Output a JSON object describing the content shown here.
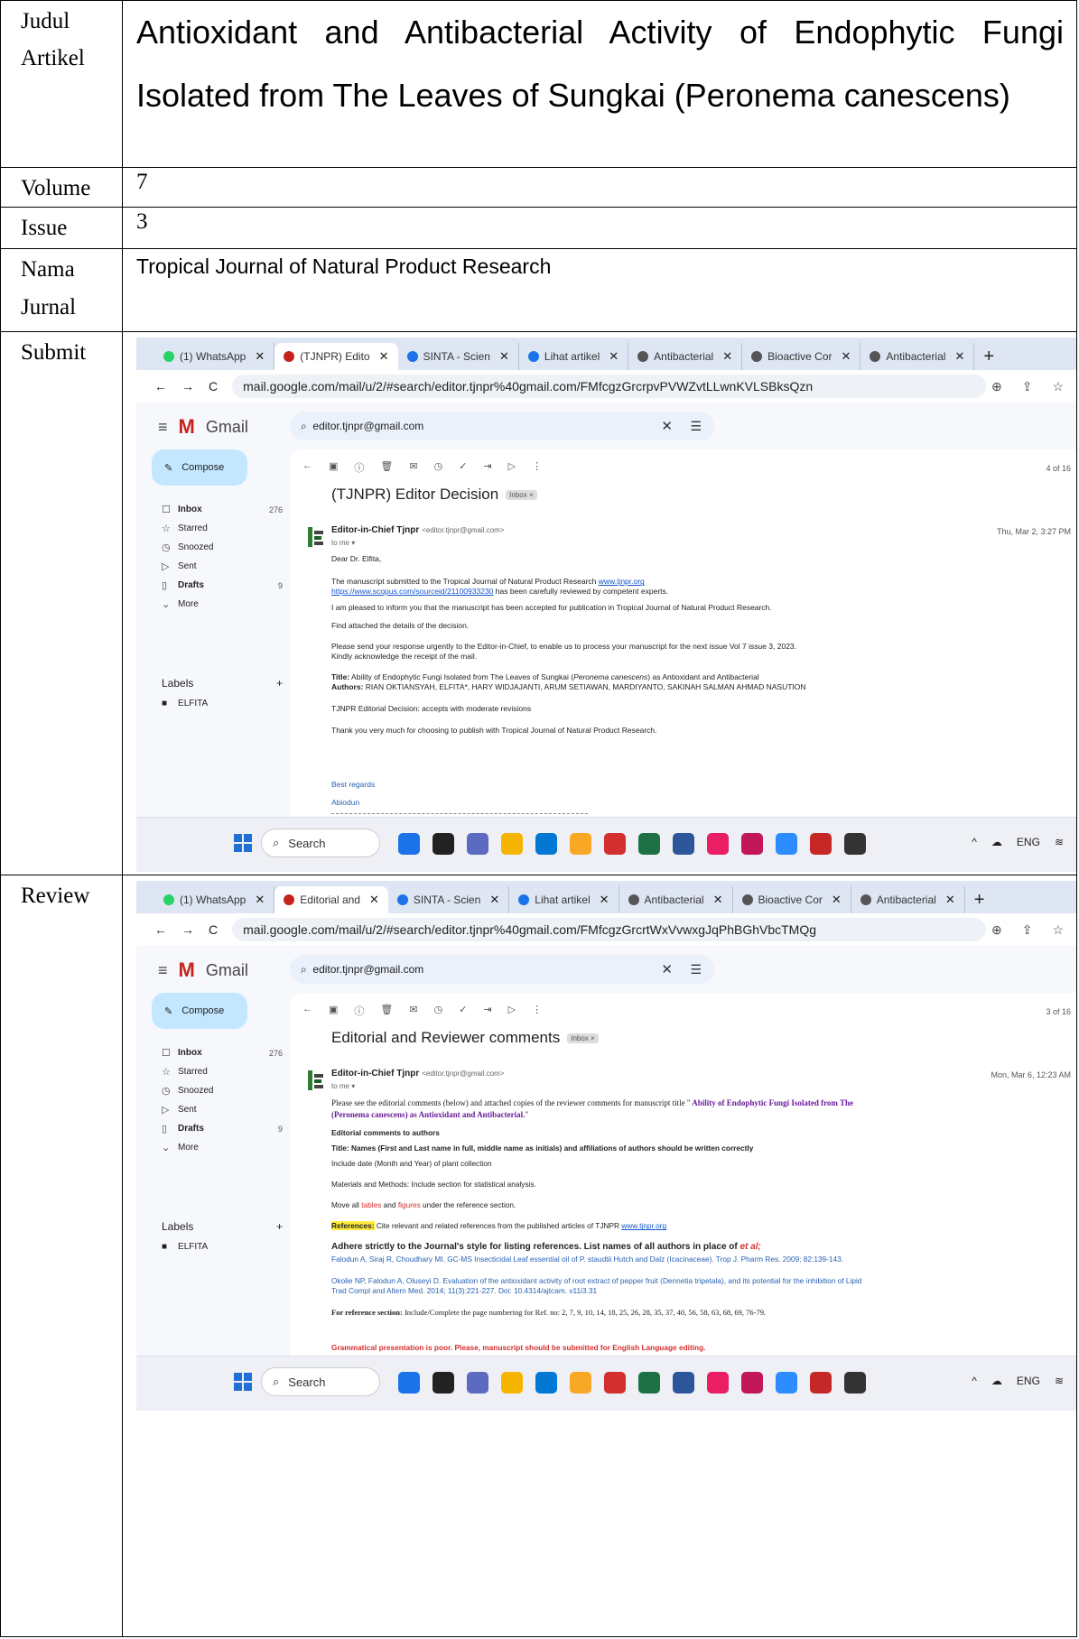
{
  "doc": {
    "rows": {
      "judul": {
        "label": "Judul Artikel",
        "value": "Antioxidant and Antibacterial Activity of Endophytic Fungi Isolated from The Leaves of Sungkai (Peronema canescens)"
      },
      "volume": {
        "label": "Volume",
        "value": "7"
      },
      "issue": {
        "label": "Issue",
        "value": "3"
      },
      "nama": {
        "label": "Nama Jurnal",
        "value": "Tropical Journal of Natural Product Research"
      },
      "submit": {
        "label": "Submit"
      },
      "review": {
        "label": "Review"
      }
    }
  },
  "colors": {
    "accent": "#1155cc",
    "compose": "#c2e7ff",
    "highlight": "#ffeb3b",
    "warning": "#d32f2f"
  },
  "browser": {
    "tabs_submit": [
      "(1) WhatsApp",
      "(TJNPR) Edito",
      "SINTA - Scien",
      "Lihat artikel",
      "Antibacterial",
      "Bioactive Cor",
      "Antibacterial"
    ],
    "tabs_review": [
      "(1) WhatsApp",
      "Editorial and",
      "SINTA - Scien",
      "Lihat artikel",
      "Antibacterial",
      "Bioactive Cor",
      "Antibacterial"
    ],
    "url_submit": "mail.google.com/mail/u/2/#search/editor.tjnpr%40gmail.com/FMfcgzGrcrpvPVWZvtLLwnKVLSBksQzn",
    "url_review": "mail.google.com/mail/u/2/#search/editor.tjnpr%40gmail.com/FMfcgzGrcrtWxVvwxgJqPhBGhVbcTMQg"
  },
  "gmail": {
    "brand": "Gmail",
    "search": "editor.tjnpr@gmail.com",
    "compose": "Compose",
    "nav": [
      {
        "label": "Inbox",
        "count": "276",
        "icon": "inbox-icon",
        "glyph": "☐"
      },
      {
        "label": "Starred",
        "count": "",
        "icon": "star-icon",
        "glyph": "☆"
      },
      {
        "label": "Snoozed",
        "count": "",
        "icon": "clock-icon",
        "glyph": "◷"
      },
      {
        "label": "Sent",
        "count": "",
        "icon": "send-icon",
        "glyph": "▷"
      },
      {
        "label": "Drafts",
        "count": "9",
        "icon": "draft-icon",
        "glyph": "▯"
      },
      {
        "label": "More",
        "count": "",
        "icon": "chevron-down-icon",
        "glyph": "⌄"
      }
    ],
    "labels_heading": "Labels",
    "label_item": "ELFITA",
    "taskbar_search": "Search",
    "tray_lang": "ENG"
  },
  "email_submit": {
    "subject": "(TJNPR) Editor Decision",
    "chip": "Inbox ×",
    "pager": "4 of 16",
    "sender_name": "Editor-in-Chief Tjnpr",
    "sender_email": "<editor.tjnpr@gmail.com>",
    "to": "to me ▾",
    "date": "Thu, Mar 2, 3:27 PM",
    "greeting": "Dear Dr. Elfita,",
    "p1": "The manuscript submitted to the Tropical Journal of Natural Product Research ",
    "p1_link": "www.tjnpr.org",
    "p2_link": "https://www.scopus.com/sourceid/21100933230",
    "p2": "  has been carefully reviewed by competent experts.",
    "p3": " I am pleased to inform you that the manuscript has been accepted for publication in Tropical Journal of Natural Product Research.",
    "p4": "Find attached the details of the decision.",
    "p5": "Please send your response urgently to the Editor-in-Chief, to enable us to process your manuscript for the next issue Vol 7 issue 3,   2023.",
    "p6": "Kindly acknowledge the receipt of the mail.",
    "title_label": "Title:",
    "title_text": " Ability of Endophytic Fungi Isolated from The Leaves of Sungkai (",
    "title_italic": "Peronema canescens",
    "title_end": ") as Antioxidant and Antibacterial",
    "authors_label": "Authors:",
    "authors_text": " RIAN OKTIANSYAH, ELFITA*, HARY WIDJAJANTI, ARUM SETIAWAN, MARDIYANTO, SAKINAH SALMAN AHMAD NASUTION",
    "decision": "TJNPR Editorial Decision: accepts with moderate revisions",
    "thanks": "Thank you very much for choosing to publish with Tropical Journal of Natural Product Research.",
    "regards": "Best regards",
    "signer": "Abiodun"
  },
  "email_review": {
    "subject": "Editorial and Reviewer comments",
    "chip": "Inbox ×",
    "pager": "3 of 16",
    "sender_name": "Editor-in-Chief Tjnpr",
    "sender_email": "<editor.tjnpr@gmail.com>",
    "to": "to me ▾",
    "date": "Mon, Mar 6, 12:23 AM",
    "intro": "Please see the editorial comments (below) and attached copies of the reviewer comments for manuscript title \"",
    "intro_title": " Ability of Endophytic Fungi Isolated from The",
    "intro_title2": "(Peronema canescens) as Antioxidant and Antibacterial.",
    "intro_end": "\"",
    "c1": "Editorial comments to authors",
    "c2": "Title: Names (First and Last name in full, middle name as initials) and affiliations of authors should be written correctly",
    "c3": "Include date (Month and Year) of plant collection",
    "c4": "Materials and Methods: Include section for statistical analysis.",
    "c5a": "Move all ",
    "c5b": "tables",
    "c5c": " and ",
    "c5d": "figures",
    "c5e": " under the reference section.",
    "c6a": "References:",
    "c6b": " Cite relevant and related references from the published articles of TJNPR ",
    "c6c": "www.tjnpr.org",
    "c7": "Adhere strictly to the Journal's style for listing references. List names of all authors in place of ",
    "c7b": "et al;",
    "c8": "Falodun A, Siraj R, Choudhary MI. GC-MS Insecticidal Leaf essential oil of P. staudtii Hutch and Dalz (Icacinaceae). Trop J. Pharm Res. 2009; 82:139-143.",
    "c9": "Okolie NP, Falodun A, Oluseyi D. Evaluation of the antioxidant activity of root extract of pepper fruit (Dennetia tripetala), and its potential for the inhibition of Lipid",
    "c10": "Trad Compl and Altern Med. 2014; 11(3):221-227. Doi: 10.4314/ajtcam. v11i3.31",
    "c11a": "For reference section:",
    "c11b": " Include/Complete the page numbering for Ref. no: 2, 7, 9, 10, 14, 18, 25, 26, 28, 35, 37, 40, 56, 58, 63, 68, 69, 76-79.",
    "c12": "Grammatical presentation is poor. Please, manuscript should be submitted for English Language editing."
  }
}
